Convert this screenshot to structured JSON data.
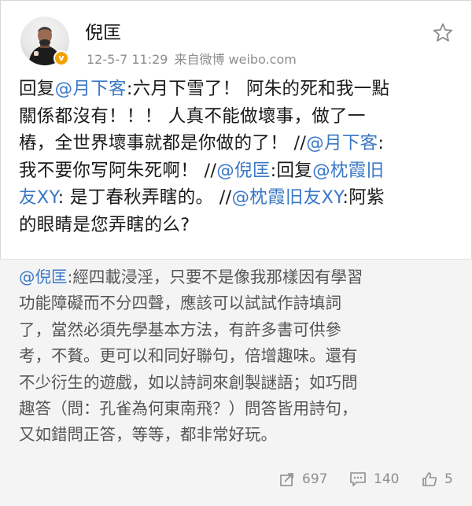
{
  "header": {
    "username": "倪匡",
    "timestamp": "12-5-7 11:29",
    "source": "来自微博 weibo.com"
  },
  "post": {
    "lines": [
      [
        {
          "t": "回复",
          "m": false
        },
        {
          "t": "@月下客",
          "m": true
        },
        {
          "t": ":六月下雪了！ 阿朱的死和我一點",
          "m": false
        }
      ],
      [
        {
          "t": "關係都沒有！！！ 人真不能做壞事，做了一",
          "m": false
        }
      ],
      [
        {
          "t": "樁，全世界壞事就都是你做的了！ //",
          "m": false
        },
        {
          "t": "@月下客",
          "m": true
        },
        {
          "t": ":",
          "m": false
        }
      ],
      [
        {
          "t": "我不要你写阿朱死啊！ //",
          "m": false
        },
        {
          "t": "@倪匡",
          "m": true
        },
        {
          "t": ":回复",
          "m": false
        },
        {
          "t": "@枕霞旧",
          "m": true
        }
      ],
      [
        {
          "t": "友XY",
          "m": true
        },
        {
          "t": ": 是丁春秋弄瞎的。 //",
          "m": false
        },
        {
          "t": "@枕霞旧友XY",
          "m": true
        },
        {
          "t": ":阿紫",
          "m": false
        }
      ],
      [
        {
          "t": "的眼睛是您弄瞎的么?",
          "m": false
        }
      ]
    ]
  },
  "quoted": {
    "lines": [
      [
        {
          "t": "@倪匡",
          "m": true
        },
        {
          "t": ":經四載浸淫，只要不是像我那樣因有學習",
          "m": false
        }
      ],
      [
        {
          "t": "功能障礙而不分四聲，應該可以試試作詩填詞",
          "m": false
        }
      ],
      [
        {
          "t": "了，當然必須先學基本方法，有許多書可供參",
          "m": false
        }
      ],
      [
        {
          "t": "考，不贅。更可以和同好聯句，倍增趣味。還有",
          "m": false
        }
      ],
      [
        {
          "t": "不少衍生的遊戲，如以詩詞來創製謎語；如巧問",
          "m": false
        }
      ],
      [
        {
          "t": "趣答（問：孔雀為何東南飛？）問答皆用詩句，",
          "m": false
        }
      ],
      [
        {
          "t": "又如錯問正答，等等，都非常好玩。",
          "m": false
        }
      ]
    ]
  },
  "actions": {
    "repost_count": "697",
    "comment_count": "140",
    "like_count": "5"
  },
  "colors": {
    "mention": "#3a78c6",
    "verified_badge": "#f2a200"
  },
  "icons": [
    "star-icon",
    "repost-icon",
    "comment-icon",
    "like-icon",
    "verified-badge-icon"
  ]
}
